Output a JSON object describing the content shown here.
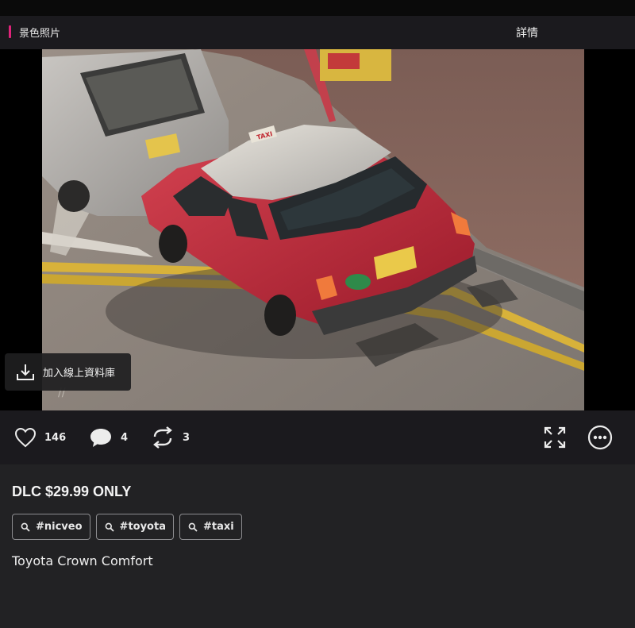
{
  "header": {
    "title": "景色照片",
    "details_label": "詳情"
  },
  "media": {
    "taxi_sign": "TAXI",
    "add_to_library_label": "加入線上資料庫"
  },
  "actions": {
    "likes": "146",
    "comments": "4",
    "reposts": "3"
  },
  "post": {
    "price_text": "DLC $29.99 ONLY",
    "tags": [
      "#nicveo",
      "#toyota",
      "#taxi"
    ],
    "description": "Toyota Crown Comfort"
  },
  "colors": {
    "accent": "#e0237a",
    "taxi_red": "#c22636",
    "taxi_roof": "#cfcfcf"
  }
}
